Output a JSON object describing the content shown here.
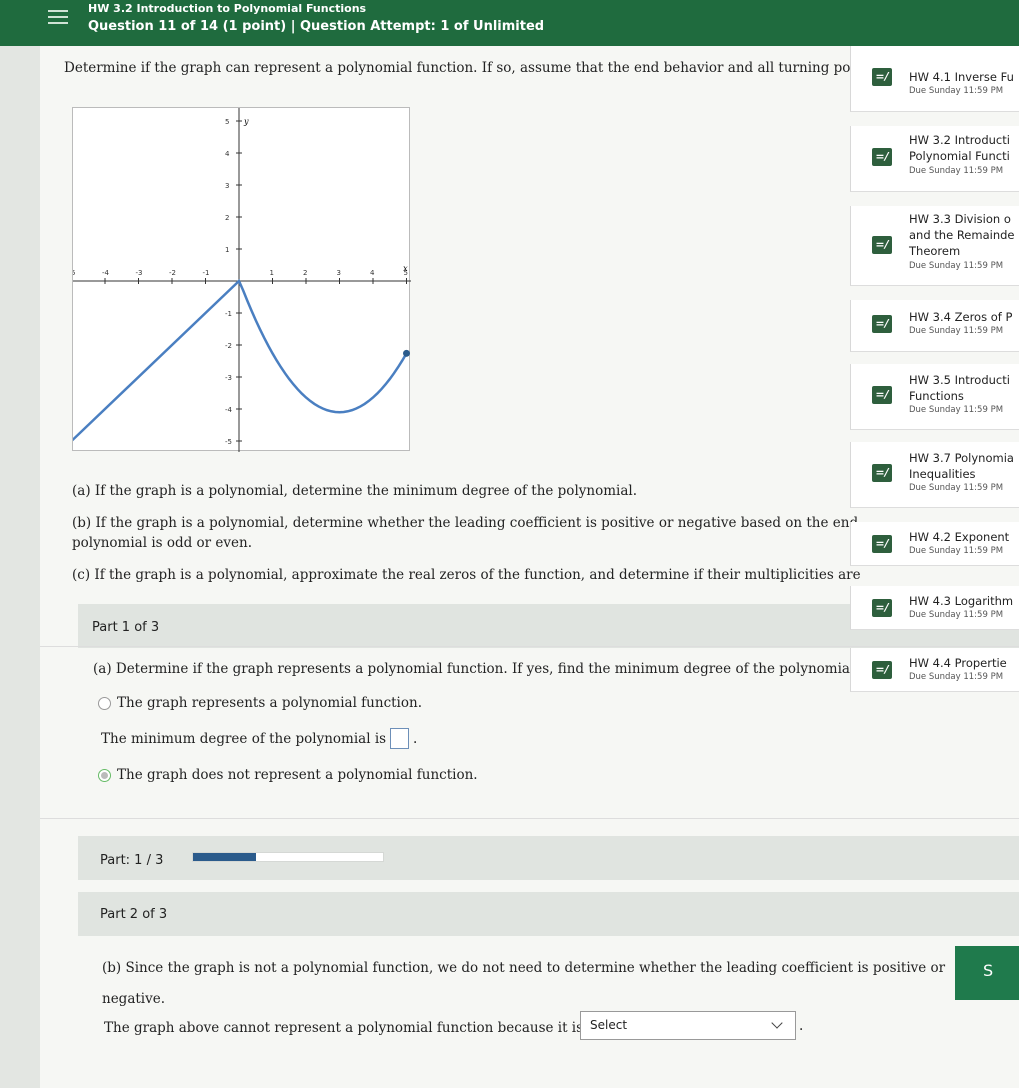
{
  "header": {
    "assignment": "HW 3.2 Introduction to Polynomial Functions",
    "question": "Question 11 of 14 (1 point)  |  Question Attempt: 1 of Unlimited"
  },
  "prompt": {
    "line1": "Determine if the graph can represent a polynomial function. If so, assume that the end behavior and all turning poi",
    "a": "(a) If the graph is a polynomial, determine the minimum degree of the polynomial.",
    "b1": "(b) If the graph is a polynomial, determine whether the leading coefficient is positive or negative based on the end",
    "b2": "polynomial is odd or even.",
    "c": "(c) If the graph is a polynomial, approximate the real zeros of the function, and determine if their multiplicities are"
  },
  "graph": {
    "x_ticks": [
      "-5",
      "-4",
      "-3",
      "-2",
      "-1",
      "1",
      "2",
      "3",
      "4",
      "5"
    ],
    "y_ticks": [
      "5",
      "4",
      "3",
      "2",
      "1",
      "-1",
      "-2",
      "-3",
      "-4",
      "-5"
    ],
    "x_label": "x",
    "y_label": "y",
    "curve_color": "#4a7fc1"
  },
  "part1": {
    "label": "Part 1 of 3",
    "question": "(a) Determine if the graph represents a polynomial function. If yes, find the minimum degree of the polynomial.",
    "option1": "The graph represents a polynomial function.",
    "min_degree_prefix": "The minimum degree of the polynomial is",
    "min_degree_suffix": ".",
    "option2": "The graph does not represent a polynomial function."
  },
  "progress": {
    "label": "Part: 1 / 3",
    "fraction": 0.333
  },
  "part2": {
    "label": "Part 2 of 3",
    "text1": "(b) Since the graph is not a polynomial function, we do not need to determine whether the leading coefficient is positive or",
    "text2": "negative.",
    "select_prefix": "The graph above cannot represent a polynomial function because it is",
    "select_value": "Select",
    "select_suffix": ".",
    "button_label": "S"
  },
  "sidebar": {
    "items": [
      {
        "title1": "HW 4.1 Inverse Fu",
        "title2": "",
        "title3": "",
        "due": "Due Sunday 11:59 PM"
      },
      {
        "title1": "HW 3.2 Introducti",
        "title2": "Polynomial Functi",
        "title3": "",
        "due": "Due Sunday 11:59 PM"
      },
      {
        "title1": "HW 3.3 Division o",
        "title2": "and the Remainde",
        "title3": "Theorem",
        "due": "Due Sunday 11:59 PM"
      },
      {
        "title1": "HW 3.4 Zeros of P",
        "title2": "",
        "title3": "",
        "due": "Due Sunday 11:59 PM"
      },
      {
        "title1": "HW 3.5 Introducti",
        "title2": "Functions",
        "title3": "",
        "due": "Due Sunday 11:59 PM"
      },
      {
        "title1": "HW 3.7 Polynomia",
        "title2": "Inequalities",
        "title3": "",
        "due": "Due Sunday 11:59 PM"
      },
      {
        "title1": "HW 4.2 Exponent",
        "title2": "",
        "title3": "",
        "due": "Due Sunday 11:59 PM"
      },
      {
        "title1": "HW 4.3 Logarithm",
        "title2": "",
        "title3": "",
        "due": "Due Sunday 11:59 PM"
      },
      {
        "title1": "HW 4.4 Propertie",
        "title2": "",
        "title3": "",
        "due": "Due Sunday 11:59 PM"
      }
    ]
  }
}
